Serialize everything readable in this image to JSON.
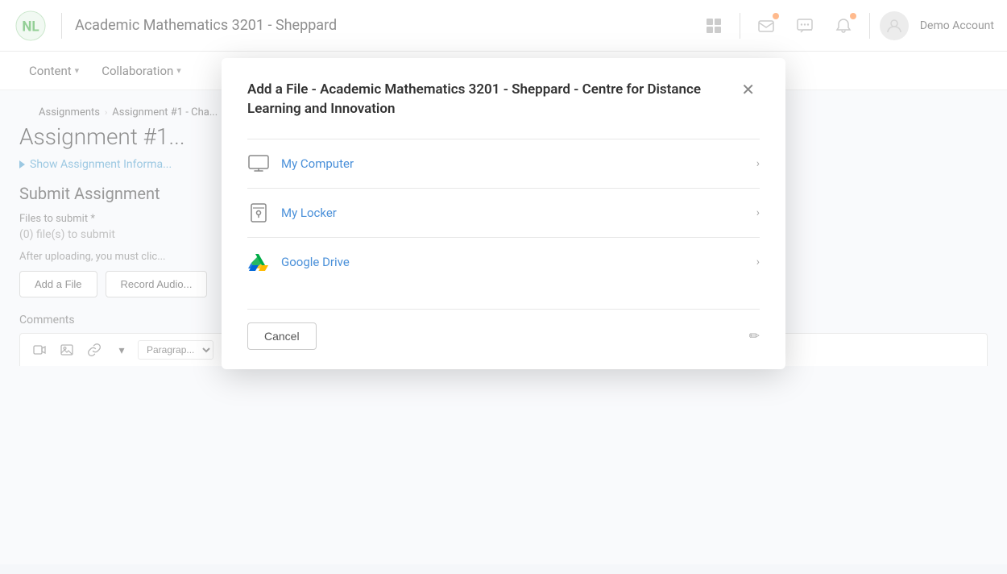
{
  "app": {
    "logo_alt": "NL Logo"
  },
  "topnav": {
    "title": "Academic Mathematics 3201 - Sheppard",
    "user_name": "Demo Account"
  },
  "subnav": {
    "items": [
      {
        "label": "Content",
        "has_dropdown": true
      },
      {
        "label": "Collaboration",
        "has_dropdown": true
      }
    ]
  },
  "breadcrumb": {
    "items": [
      "Assignments",
      "Assignment #1 - Cha..."
    ]
  },
  "page": {
    "assignment_title": "Assignment #1...",
    "show_info_label": "Show Assignment Informa...",
    "submit_title": "Submit Assignment",
    "files_label": "Files to submit *",
    "files_count": "(0) file(s) to submit",
    "after_upload_text": "After uploading, you must clic...",
    "add_file_btn": "Add a File",
    "record_audio_btn": "Record Audio...",
    "comments_label": "Comments",
    "paragraph_placeholder": "Paragrap..."
  },
  "modal": {
    "title": "Add a File - Academic Mathematics 3201 - Sheppard - Centre for Distance Learning and Innovation",
    "options": [
      {
        "id": "my-computer",
        "label": "My Computer",
        "icon_type": "monitor"
      },
      {
        "id": "my-locker",
        "label": "My Locker",
        "icon_type": "locker"
      },
      {
        "id": "google-drive",
        "label": "Google Drive",
        "icon_type": "gdrive"
      }
    ],
    "cancel_label": "Cancel"
  }
}
